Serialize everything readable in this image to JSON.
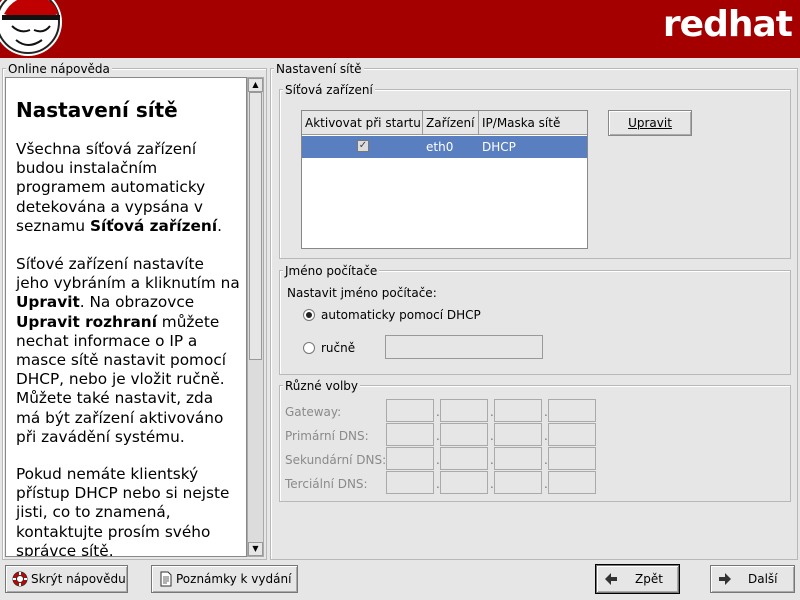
{
  "header": {
    "brand": "redhat"
  },
  "help": {
    "frame_label": "Online nápověda",
    "title": "Nastavení sítě",
    "paragraphs": [
      [
        "Všechna síťová zařízení budou instalačním programem automaticky detekována a vypsána v seznamu ",
        {
          "b": "Síťová zařízení"
        },
        "."
      ],
      [
        "Síťové zařízení nastavíte jeho vybráním a kliknutím na ",
        {
          "b": "Upravit"
        },
        ". Na obrazovce ",
        {
          "b": "Upravit rozhraní"
        },
        " můžete nechat informace o IP a masce sítě nastavit pomocí DHCP, nebo je vložit ručně. Můžete také nastavit, zda má být zařízení aktivováno při zavádění systému."
      ],
      [
        "Pokud nemáte klientský přístup DHCP nebo si nejste jisti, co to znamená, kontaktujte prosím svého správce sítě."
      ]
    ]
  },
  "network": {
    "frame_label": "Nastavení sítě",
    "devices": {
      "frame_label": "Síťová zařízení",
      "columns": [
        "Aktivovat při startu",
        "Zařízení",
        "IP/Maska sítě"
      ],
      "rows": [
        {
          "active": true,
          "device": "eth0",
          "ip": "DHCP"
        }
      ],
      "edit_label": "Upravit"
    },
    "hostname": {
      "frame_label": "Jméno počítače",
      "set_label": "Nastavit jméno počítače:",
      "auto_label": "automaticky pomocí DHCP",
      "manual_label": "ručně",
      "selected": "auto",
      "manual_value": ""
    },
    "misc": {
      "frame_label": "Různé volby",
      "fields": [
        "Gateway:",
        "Primární DNS:",
        "Sekundární DNS:",
        "Terciální DNS:"
      ]
    }
  },
  "footer": {
    "hide_help": "Skrýt nápovědu",
    "release_notes": "Poznámky k vydání",
    "back": "Zpět",
    "next": "Další"
  },
  "colors": {
    "header": "#a40000",
    "selection": "#5a7fc0",
    "background": "#e6e6e6"
  }
}
